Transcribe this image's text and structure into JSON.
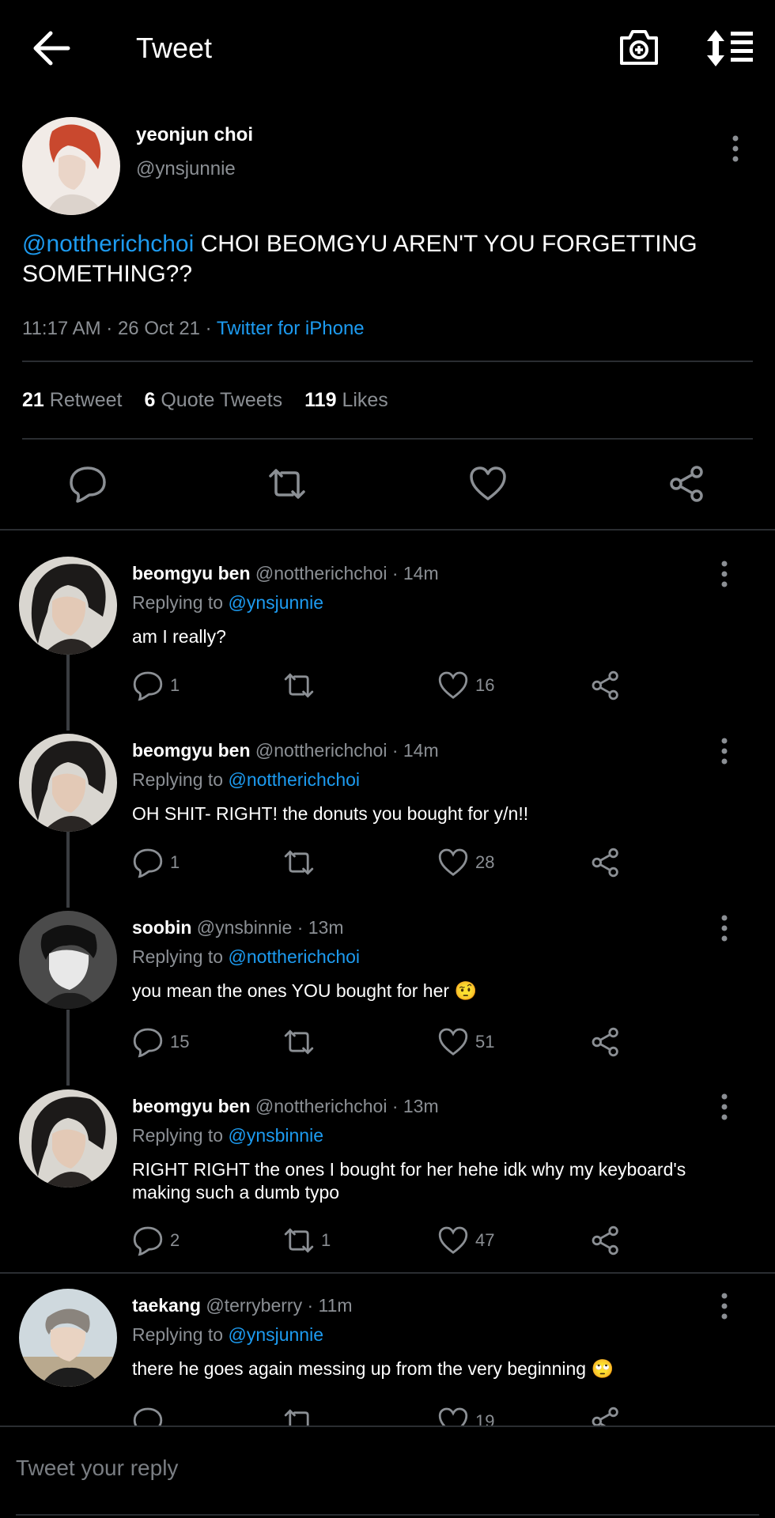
{
  "header": {
    "title": "Tweet"
  },
  "main_tweet": {
    "name": "yeonjun choi",
    "handle": "@ynsjunnie",
    "mention": "@nottherichchoi",
    "text": " CHOI BEOMGYU AREN'T YOU FORGETTING SOMETHING??",
    "time": "11:17 AM · 26 Oct 21 · ",
    "source": "Twitter for iPhone",
    "retweets": "21",
    "retweets_label": "Retweet",
    "quotes": "6",
    "quotes_label": "Quote Tweets",
    "likes": "119",
    "likes_label": "Likes"
  },
  "replies": [
    {
      "name": "beomgyu ben",
      "meta": "@nottherichchoi · 14m",
      "replying_prefix": "Replying to ",
      "replying_to": "@ynsjunnie",
      "text": "am I really?",
      "replies": "1",
      "retweets": "",
      "likes": "16"
    },
    {
      "name": "beomgyu ben",
      "meta": "@nottherichchoi · 14m",
      "replying_prefix": "Replying to ",
      "replying_to": "@nottherichchoi",
      "text": "OH SHIT- RIGHT! the donuts you bought for y/n!!",
      "replies": "1",
      "retweets": "",
      "likes": "28"
    },
    {
      "name": "soobin",
      "meta": "@ynsbinnie · 13m",
      "replying_prefix": "Replying to ",
      "replying_to": "@nottherichchoi",
      "text": "you mean the ones YOU bought for her 🤨",
      "replies": "15",
      "retweets": "",
      "likes": "51"
    },
    {
      "name": "beomgyu ben",
      "meta": "@nottherichchoi · 13m",
      "replying_prefix": "Replying to ",
      "replying_to": "@ynsbinnie",
      "text": "RIGHT RIGHT the ones I bought for her hehe idk why my keyboard's making such a dumb typo",
      "replies": "2",
      "retweets": "1",
      "likes": "47"
    },
    {
      "name": "taekang",
      "meta": "@terryberry · 11m",
      "replying_prefix": "Replying to ",
      "replying_to": "@ynsjunnie",
      "text": "there he goes again messing up from the very beginning 🙄",
      "replies": "",
      "retweets": "",
      "likes": "19"
    }
  ],
  "composer": {
    "placeholder": "Tweet your reply"
  },
  "colors": {
    "background": "#000000",
    "accent": "#1d9bf0",
    "muted": "#8b8f94",
    "text": "#e7e9ea"
  },
  "icons": [
    "back-arrow-icon",
    "camera-add-icon",
    "sort-icon",
    "more-icon",
    "reply-icon",
    "retweet-icon",
    "like-icon",
    "share-icon"
  ]
}
